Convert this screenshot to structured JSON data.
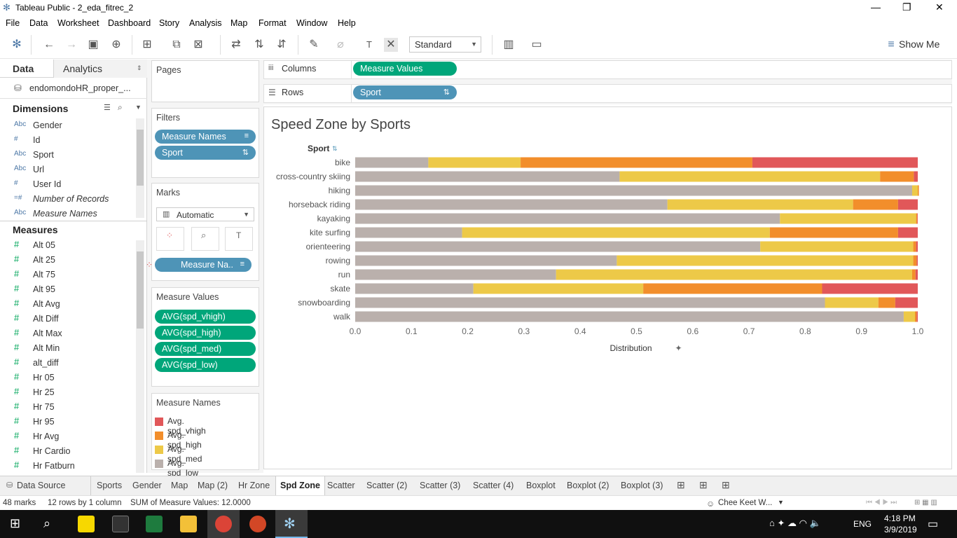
{
  "window": {
    "title": "Tableau Public - 2_eda_fitrec_2"
  },
  "menu": [
    "File",
    "Data",
    "Worksheet",
    "Dashboard",
    "Story",
    "Analysis",
    "Map",
    "Format",
    "Window",
    "Help"
  ],
  "toolbar": {
    "fit_dropdown": "Standard",
    "show_me": "Show Me"
  },
  "data_pane": {
    "tab_data": "Data",
    "tab_analytics": "Analytics",
    "datasource": "endomondoHR_proper_...",
    "dimensions_header": "Dimensions",
    "dimensions": [
      {
        "icon": "Abc",
        "name": "Gender"
      },
      {
        "icon": "#",
        "name": "Id"
      },
      {
        "icon": "Abc",
        "name": "Sport"
      },
      {
        "icon": "Abc",
        "name": "Url"
      },
      {
        "icon": "#",
        "name": "User Id"
      },
      {
        "icon": "=#",
        "name": "Number of Records"
      },
      {
        "icon": "Abc",
        "name": "Measure Names"
      }
    ],
    "measures_header": "Measures",
    "measures": [
      "Alt 05",
      "Alt 25",
      "Alt 75",
      "Alt 95",
      "Alt Avg",
      "Alt Diff",
      "Alt Max",
      "Alt Min",
      "alt_diff",
      "Hr 05",
      "Hr 25",
      "Hr 75",
      "Hr 95",
      "Hr Avg",
      "Hr Cardio",
      "Hr Fatburn"
    ]
  },
  "cards": {
    "pages": "Pages",
    "filters": "Filters",
    "filter_pills": [
      "Measure Names",
      "Sport"
    ],
    "marks": "Marks",
    "mark_type": "Automatic",
    "marks_pill": "Measure Na..",
    "measure_values": "Measure Values",
    "measure_value_pills": [
      "AVG(spd_vhigh)",
      "AVG(spd_high)",
      "AVG(spd_med)",
      "AVG(spd_low)"
    ],
    "measure_names": "Measure Names",
    "legend": [
      {
        "label": "Avg. spd_vhigh",
        "color": "#e15759"
      },
      {
        "label": "Avg. spd_high",
        "color": "#f28e2b"
      },
      {
        "label": "Avg. spd_med",
        "color": "#edc948"
      },
      {
        "label": "Avg. spd_low",
        "color": "#bab0ac"
      }
    ]
  },
  "shelves": {
    "columns_label": "Columns",
    "columns_pill": "Measure Values",
    "rows_label": "Rows",
    "rows_pill": "Sport"
  },
  "chart_data": {
    "type": "bar",
    "title": "Speed Zone by Sports",
    "ylabel": "Sport",
    "xlabel": "Distribution",
    "xlim": [
      0,
      1
    ],
    "xticks": [
      "0.0",
      "0.1",
      "0.2",
      "0.3",
      "0.4",
      "0.5",
      "0.6",
      "0.7",
      "0.8",
      "0.9",
      "1.0"
    ],
    "stacked": true,
    "categories": [
      "bike",
      "cross-country skiing",
      "hiking",
      "horseback riding",
      "kayaking",
      "kite surfing",
      "orienteering",
      "rowing",
      "run",
      "skate",
      "snowboarding",
      "walk"
    ],
    "series": [
      {
        "name": "Avg. spd_low",
        "color": "#bab0ac",
        "values": [
          0.13,
          0.47,
          0.99,
          0.555,
          0.755,
          0.19,
          0.72,
          0.465,
          0.357,
          0.21,
          0.835,
          0.975
        ]
      },
      {
        "name": "Avg. spd_med",
        "color": "#edc948",
        "values": [
          0.164,
          0.463,
          0.01,
          0.33,
          0.242,
          0.547,
          0.272,
          0.527,
          0.633,
          0.302,
          0.095,
          0.02
        ]
      },
      {
        "name": "Avg. spd_high",
        "color": "#f28e2b",
        "values": [
          0.412,
          0.06,
          0.002,
          0.08,
          0.002,
          0.228,
          0.005,
          0.006,
          0.006,
          0.318,
          0.03,
          0.003
        ]
      },
      {
        "name": "Avg. spd_vhigh",
        "color": "#e15759",
        "values": [
          0.294,
          0.007,
          0.0,
          0.035,
          0.001,
          0.035,
          0.003,
          0.002,
          0.004,
          0.17,
          0.04,
          0.002
        ]
      }
    ]
  },
  "sheet_tabs": [
    "Data Source",
    "Sports",
    "Gender",
    "Map",
    "Map (2)",
    "Hr Zone",
    "Spd Zone",
    "Scatter",
    "Scatter (2)",
    "Scatter (3)",
    "Scatter (4)",
    "Boxplot",
    "Boxplot (2)",
    "Boxplot (3)"
  ],
  "active_tab": "Spd Zone",
  "status": {
    "marks": "48 marks",
    "rows": "12 rows by 1 column",
    "sum": "SUM of Measure Values: 12.0000",
    "user": "Chee Keet W..."
  },
  "taskbar": {
    "lang": "ENG",
    "time": "4:18 PM",
    "date": "3/9/2019"
  }
}
